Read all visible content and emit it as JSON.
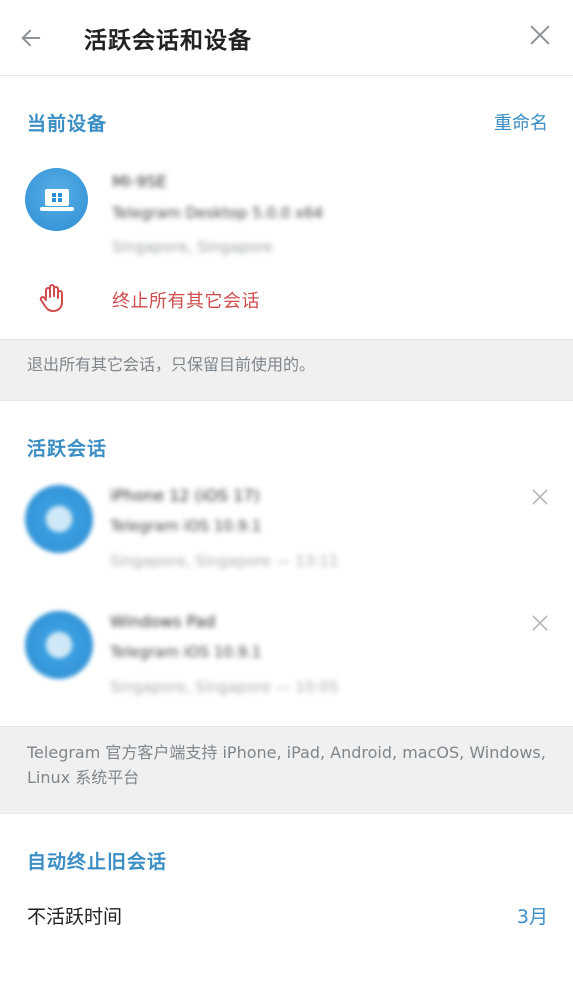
{
  "header": {
    "title": "活跃会话和设备",
    "back_icon": "arrow-left-icon",
    "close_icon": "close-icon"
  },
  "current_device": {
    "section_title": "当前设备",
    "rename_label": "重命名",
    "device_name": "MI-9SE",
    "device_app": "Telegram Desktop 5.0.0 x64",
    "device_location": "Singapore, Singapore",
    "terminate_label": "终止所有其它会话"
  },
  "note_logout": "退出所有其它会话，只保留目前使用的。",
  "active_sessions": {
    "section_title": "活跃会话",
    "items": [
      {
        "name": "iPhone 12 (iOS 17)",
        "app": "Telegram iOS 10.9.1",
        "location": "Singapore, Singapore — 13:11"
      },
      {
        "name": "Windows Pad",
        "app": "Telegram iOS 10.9.1",
        "location": "Singapore, Singapore — 10:05"
      }
    ]
  },
  "note_platforms": "Telegram 官方客户端支持 iPhone, iPad, Android, macOS, Windows, Linux 系统平台",
  "auto_terminate": {
    "section_title": "自动终止旧会话",
    "inactive_label": "不活跃时间",
    "inactive_value": "3月"
  },
  "colors": {
    "accent": "#3a8ec4",
    "danger": "#cf4d4d",
    "muted": "#7f868b",
    "avatar": "#2c8fd3"
  }
}
